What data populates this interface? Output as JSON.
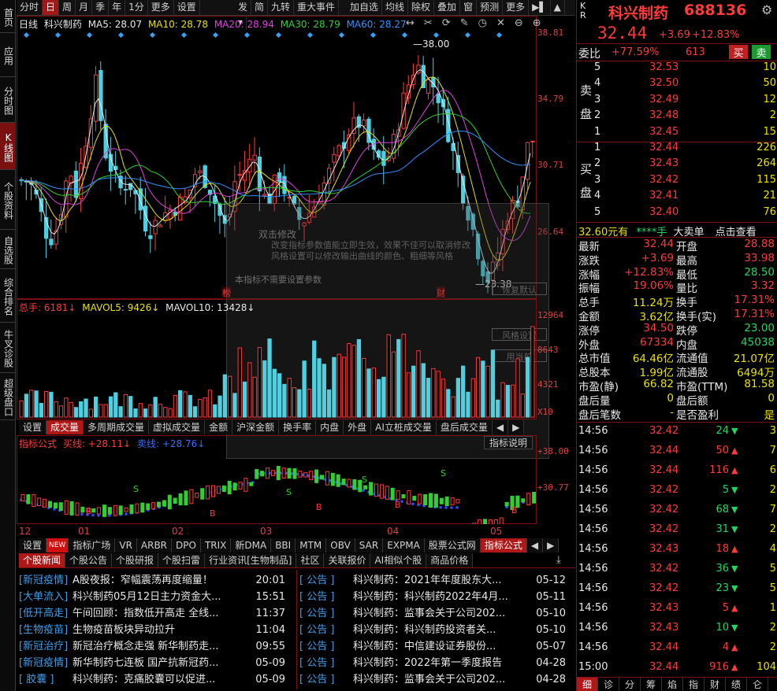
{
  "leftnav": [
    "首页",
    "应用",
    "分时图",
    "K线图",
    "个股资料",
    "自选股",
    "综合排名",
    "牛叉诊股",
    "超级盘口"
  ],
  "toolbar": {
    "periods": [
      "分时",
      "日",
      "周",
      "月",
      "季",
      "年",
      "1分",
      "更多",
      "设置"
    ],
    "tools": [
      "发",
      "简",
      "九转",
      "重大事件"
    ],
    "right": [
      "加自选",
      "均线",
      "除权",
      "叠加",
      "窗",
      "预测",
      "更多"
    ]
  },
  "legend": {
    "period": "日线",
    "name": "科兴制药",
    "ma5": "MA5: 28.07",
    "ma10": "MA10: 28.78",
    "ma20": "MA20: 28.94",
    "ma30": "MA30: 28.79",
    "ma60": "MA60: 28.27"
  },
  "price_axis": [
    "38.81",
    "34.79",
    "30.71",
    "26.64"
  ],
  "annotations": {
    "high": "38.00",
    "low": "23.38",
    "mark1": "榜",
    "mark2": "财"
  },
  "overlay": {
    "title": "双击修改",
    "desc1": "改变指标参数值能立即生效，效果不佳可以取消修改",
    "desc2": "风格设置可以修改输出曲线的颜色、粗细等风格",
    "note": "本指标不需要设置参数",
    "btn": "风格设置",
    "btn2": "恢复默认",
    "btn3": "用当前"
  },
  "vol_legend": {
    "total": "总手: 6181↓",
    "mavol5": "MAVOL5: 9426↓",
    "mavol10": "MAVOL10: 13428↓"
  },
  "vol_axis": [
    "12964",
    "8643",
    "4321",
    "X10"
  ],
  "mid_tabs": [
    "设置",
    "成交量",
    "多周期成交量",
    "虚拟成交量",
    "金额",
    "沪深金额",
    "换手率",
    "内盘",
    "外盘",
    "AI立桩成交量",
    "盘后成交量"
  ],
  "ind_legend": {
    "name": "指标公式",
    "buy": "买线: +28.11↓",
    "sell": "卖线: +28.76↓",
    "help": "指标说明"
  },
  "ind_axis": [
    "+38.00",
    "+30.77"
  ],
  "months": [
    "12",
    "01",
    "02",
    "03",
    "04",
    "05"
  ],
  "bot_tabs": [
    "设置",
    "NEW",
    "指标广场",
    "VR",
    "ARBR",
    "DPO",
    "TRIX",
    "新DMA",
    "BBI",
    "MTM",
    "OBV",
    "SAR",
    "EXPMA",
    "股票公式网",
    "指标公式"
  ],
  "news_tabs": [
    "个股新闻",
    "个股公告",
    "个股研报",
    "个股扫雷",
    "行业资讯[生物制品]",
    "社区",
    "关联报价",
    "AI相似个股",
    "商品价格"
  ],
  "news_left": [
    {
      "tag": "[新冠疫情]",
      "title": "A股夜报：窄幅震荡再度缩量！",
      "time": "20:01"
    },
    {
      "tag": "[大单流入]",
      "title": "科兴制药05月12日主力资金大...",
      "time": "15:51"
    },
    {
      "tag": "[低开高走]",
      "title": "午间回顾：指数低开高走 全线...",
      "time": "11:37"
    },
    {
      "tag": "[生物疫苗]",
      "title": "生物疫苗板块异动拉升",
      "time": "11:04"
    },
    {
      "tag": "[新冠治疗]",
      "title": "新冠治疗概念走强 新华制药走...",
      "time": "09:55"
    },
    {
      "tag": "[新冠疫情]",
      "title": "新华制药七连板 国产抗新冠药...",
      "time": "05-09"
    },
    {
      "tag": "[ 胶囊 ]",
      "title": "科兴制药：克痛胶囊可以促进...",
      "time": "05-09"
    }
  ],
  "news_right": [
    {
      "tag": "[ 公告 ]",
      "title": "科兴制药：2021年年度股东大...",
      "time": "05-12"
    },
    {
      "tag": "[ 公告 ]",
      "title": "科兴制药：科兴制药2022年4月...",
      "time": "05-11"
    },
    {
      "tag": "[ 公告 ]",
      "title": "科兴制药：监事会关于公司202...",
      "time": "05-10"
    },
    {
      "tag": "[ 公告 ]",
      "title": "科兴制药：科兴制药投资者关...",
      "time": "05-10"
    },
    {
      "tag": "[ 公告 ]",
      "title": "科兴制药：中信建设证券股份...",
      "time": "05-07"
    },
    {
      "tag": "[ 公告 ]",
      "title": "科兴制药：2022年第一季度报告",
      "time": "04-28"
    },
    {
      "tag": "[ 公告 ]",
      "title": "科兴制药：监事会关于公司202...",
      "time": "04-28"
    }
  ],
  "quote": {
    "kr": "K\nR",
    "name": "科兴制药",
    "code": "688136",
    "price": "32.44",
    "chg": "+3.69",
    "pct": "+12.83%",
    "weibi_lbl": "委比",
    "weibi": "+77.59%",
    "weicha": "613",
    "buy_btn": "买",
    "sell_btn": "卖"
  },
  "asks": [
    {
      "l": "5",
      "p": "32.53",
      "v": "10"
    },
    {
      "l": "4",
      "p": "32.50",
      "v": "50"
    },
    {
      "l": "3",
      "p": "32.49",
      "v": "12"
    },
    {
      "l": "2",
      "p": "32.48",
      "v": "2"
    },
    {
      "l": "1",
      "p": "32.45",
      "v": "15"
    }
  ],
  "bids": [
    {
      "l": "1",
      "p": "32.44",
      "v": "226"
    },
    {
      "l": "2",
      "p": "32.43",
      "v": "264"
    },
    {
      "l": "3",
      "p": "32.42",
      "v": "115"
    },
    {
      "l": "4",
      "p": "32.41",
      "v": "21"
    },
    {
      "l": "5",
      "p": "32.40",
      "v": "76"
    }
  ],
  "ask_lbl": "卖\n盘",
  "bid_lbl": "买\n盘",
  "big": {
    "price": "32.60元有",
    "stars": "****手",
    "label": "大卖单",
    "link": "点击查看"
  },
  "stats": [
    [
      "最新",
      "32.44",
      "开盘",
      "28.88"
    ],
    [
      "涨跌",
      "+3.69",
      "最高",
      "33.98"
    ],
    [
      "涨幅",
      "+12.83%",
      "最低",
      "28.50"
    ],
    [
      "振幅",
      "19.06%",
      "量比",
      "3.32"
    ],
    [
      "总手",
      "11.24万",
      "换手",
      "17.31%"
    ],
    [
      "金额",
      "3.62亿",
      "换手(实)",
      "17.31%"
    ],
    [
      "涨停",
      "34.50",
      "跌停",
      "23.00"
    ],
    [
      "外盘",
      "67334",
      "内盘",
      "45038"
    ],
    [
      "总市值",
      "64.46亿",
      "流通值",
      "21.07亿"
    ],
    [
      "总股本",
      "1.99亿",
      "流通股",
      "6494万"
    ],
    [
      "市盈(静)",
      "66.82",
      "市盈(TTM)",
      "81.58"
    ],
    [
      "盘后量",
      "0",
      "盘后额",
      "0"
    ],
    [
      "盘后笔数",
      "-",
      "是否盈利",
      "是"
    ]
  ],
  "ticks": [
    {
      "t": "14:56",
      "p": "32.42",
      "v": "24",
      "d": "down",
      "n": "3"
    },
    {
      "t": "14:56",
      "p": "32.44",
      "v": "50",
      "d": "up",
      "n": "7"
    },
    {
      "t": "14:56",
      "p": "32.44",
      "v": "116",
      "d": "up",
      "n": "6"
    },
    {
      "t": "14:56",
      "p": "32.42",
      "v": "5",
      "d": "down",
      "n": "2"
    },
    {
      "t": "14:56",
      "p": "32.42",
      "v": "68",
      "d": "down",
      "n": "7"
    },
    {
      "t": "14:56",
      "p": "32.42",
      "v": "31",
      "d": "down",
      "n": "2"
    },
    {
      "t": "14:56",
      "p": "32.43",
      "v": "18",
      "d": "up",
      "n": "4"
    },
    {
      "t": "14:56",
      "p": "32.42",
      "v": "36",
      "d": "down",
      "n": "5"
    },
    {
      "t": "14:56",
      "p": "32.42",
      "v": "23",
      "d": "down",
      "n": "5"
    },
    {
      "t": "14:56",
      "p": "32.43",
      "v": "5",
      "d": "up",
      "n": "1"
    },
    {
      "t": "14:56",
      "p": "32.43",
      "v": "10",
      "d": "down",
      "n": "2"
    },
    {
      "t": "14:56",
      "p": "32.44",
      "v": "4",
      "d": "up",
      "n": "2"
    },
    {
      "t": "15:00",
      "p": "32.44",
      "v": "916",
      "d": "up",
      "n": "104"
    }
  ],
  "bottom_tabs": [
    "细",
    "诊",
    "分",
    "筹",
    "焰",
    "指",
    "财",
    "绩",
    "仑"
  ]
}
